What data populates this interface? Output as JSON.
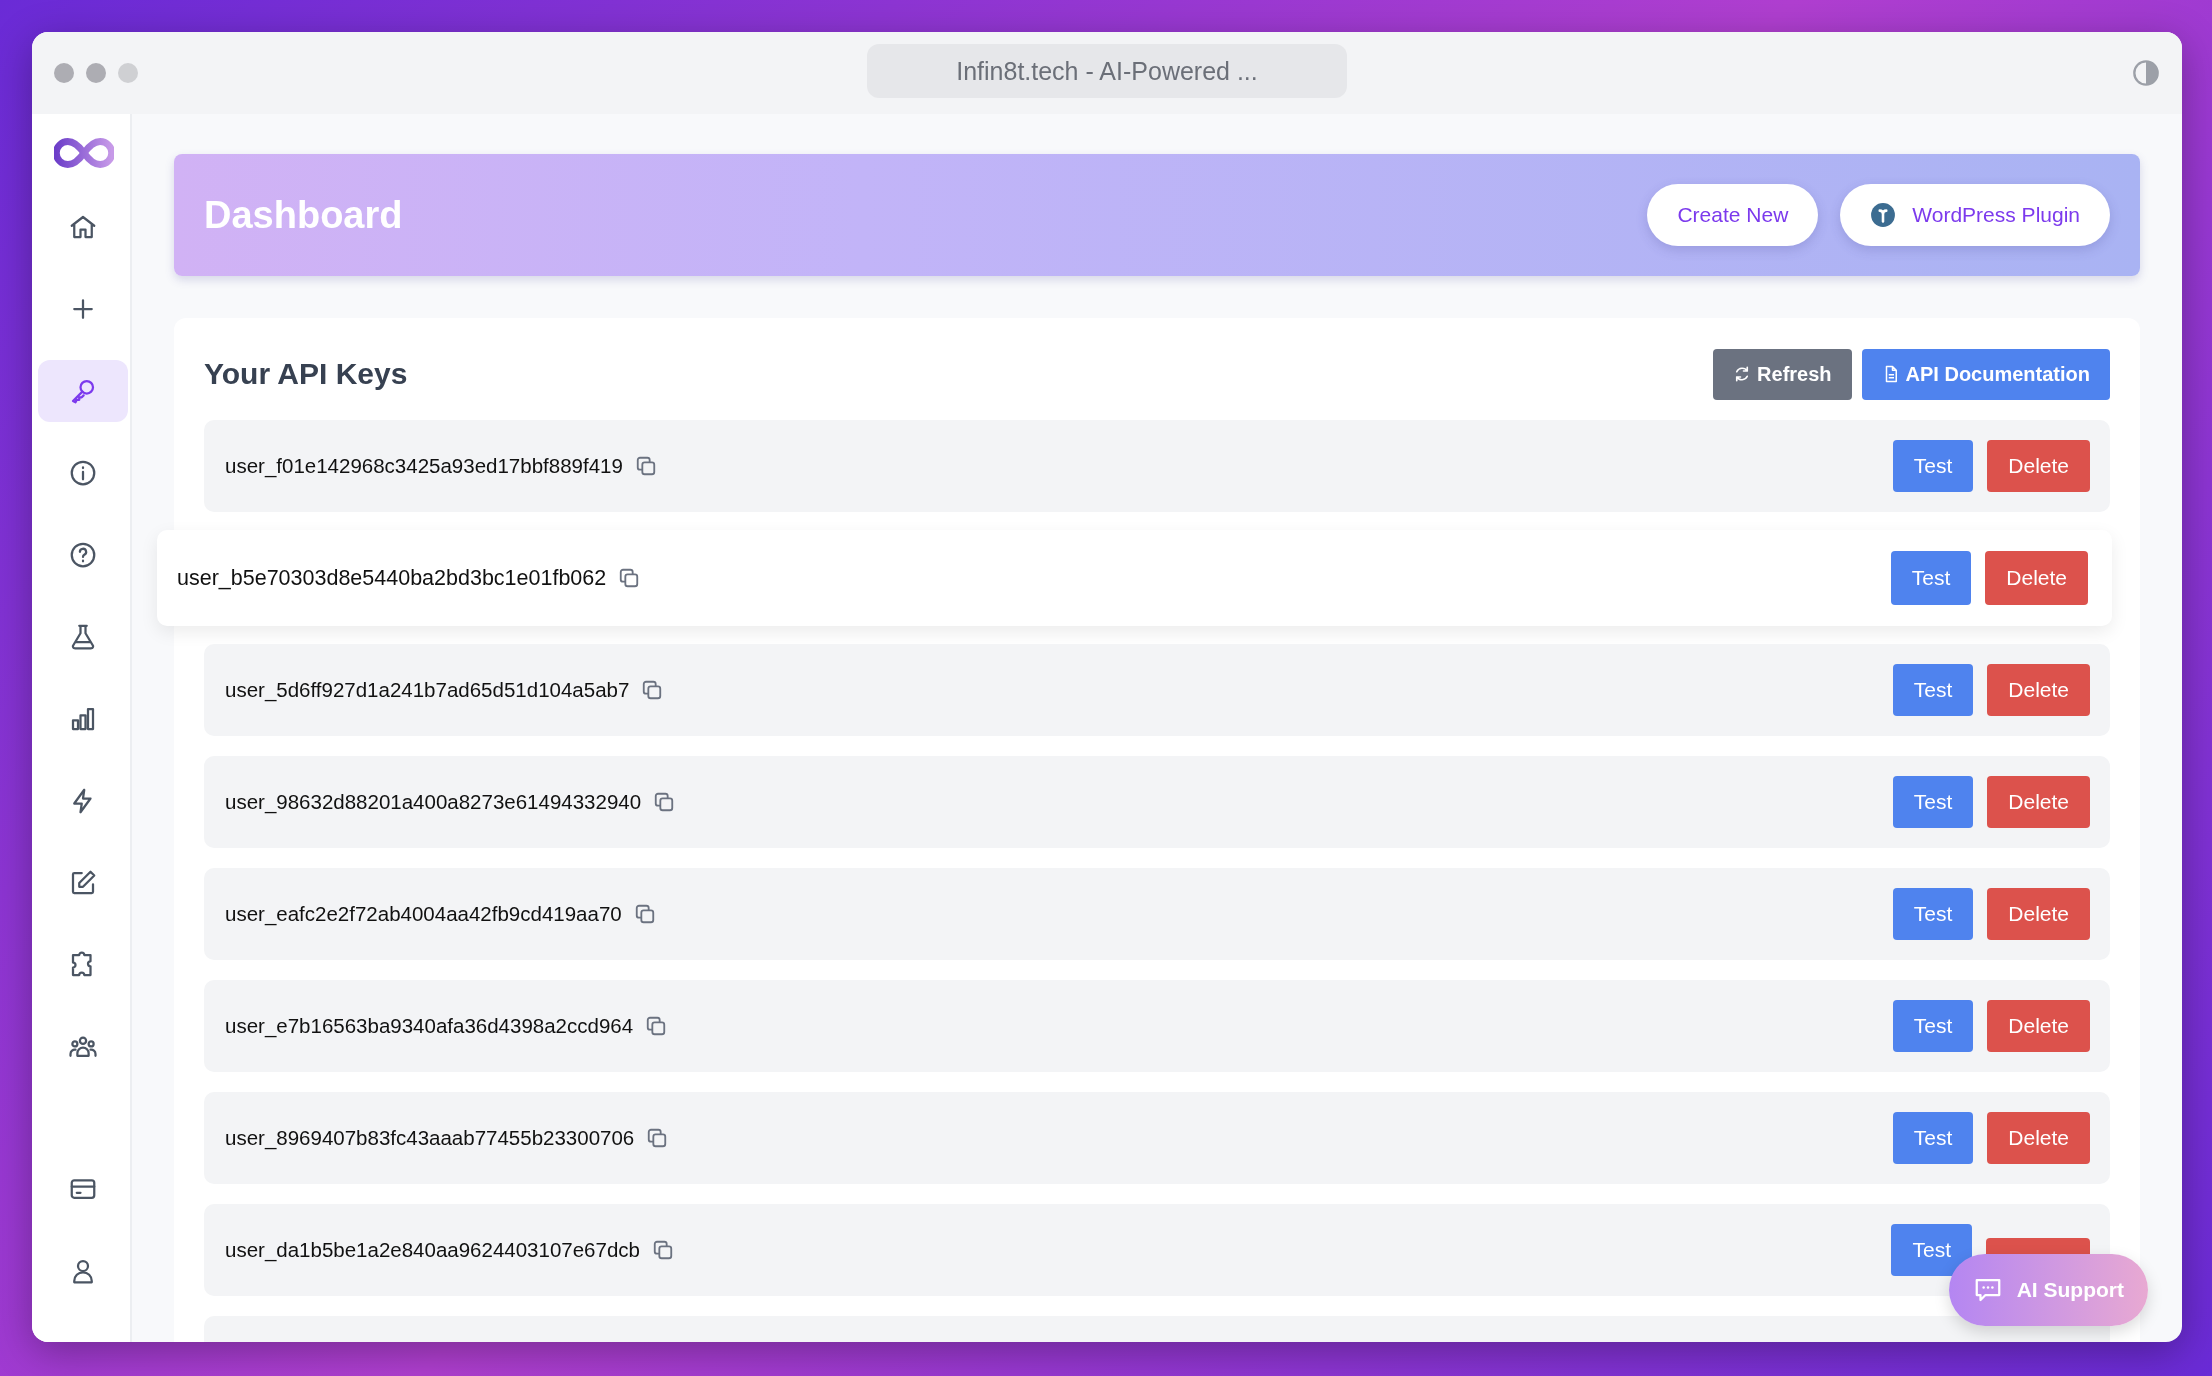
{
  "window": {
    "title": "Infin8t.tech - AI-Powered ..."
  },
  "sidebar": {
    "items": [
      {
        "selected": false
      },
      {
        "selected": false
      },
      {
        "selected": true
      },
      {
        "selected": false
      },
      {
        "selected": false
      },
      {
        "selected": false
      },
      {
        "selected": false
      },
      {
        "selected": false
      },
      {
        "selected": false
      },
      {
        "selected": false
      },
      {
        "selected": false
      },
      {
        "selected": false
      },
      {
        "selected": false
      }
    ]
  },
  "header": {
    "title": "Dashboard",
    "buttons": [
      {
        "label": "Create New",
        "kind": "plain"
      },
      {
        "label": "WordPress Plugin",
        "kind": "plugin"
      }
    ]
  },
  "api_keys": {
    "title": "Your API Keys",
    "actions": [
      {
        "label": "Refresh",
        "kind": "refresh"
      },
      {
        "label": "API Documentation",
        "kind": "docs"
      }
    ],
    "rows": [
      {
        "key": "user_f01e142968c3425a93ed17bbf889f419",
        "kind": "normal",
        "test": "Test",
        "delete": "Delete"
      },
      {
        "key": "user_b5e70303d8e5440ba2bd3bc1e01fb062",
        "kind": "lifted",
        "test": "Test",
        "delete": "Delete"
      },
      {
        "key": "user_5d6ff927d1a241b7ad65d51d104a5ab7",
        "kind": "normal",
        "test": "Test",
        "delete": "Delete"
      },
      {
        "key": "user_98632d88201a400a8273e61494332940",
        "kind": "normal",
        "test": "Test",
        "delete": "Delete"
      },
      {
        "key": "user_eafc2e2f72ab4004aa42fb9cd419aa70",
        "kind": "normal",
        "test": "Test",
        "delete": "Delete"
      },
      {
        "key": "user_e7b16563ba9340afa36d4398a2ccd964",
        "kind": "normal",
        "test": "Test",
        "delete": "Delete"
      },
      {
        "key": "user_8969407b83fc43aaab77455b23300706",
        "kind": "normal",
        "test": "Test",
        "delete": "Delete"
      },
      {
        "key": "user_da1b5be1a2e840aa9624403107e67dcb",
        "kind": "normal",
        "test": "Test"
      }
    ]
  },
  "support_button": {
    "label": "AI Support"
  }
}
